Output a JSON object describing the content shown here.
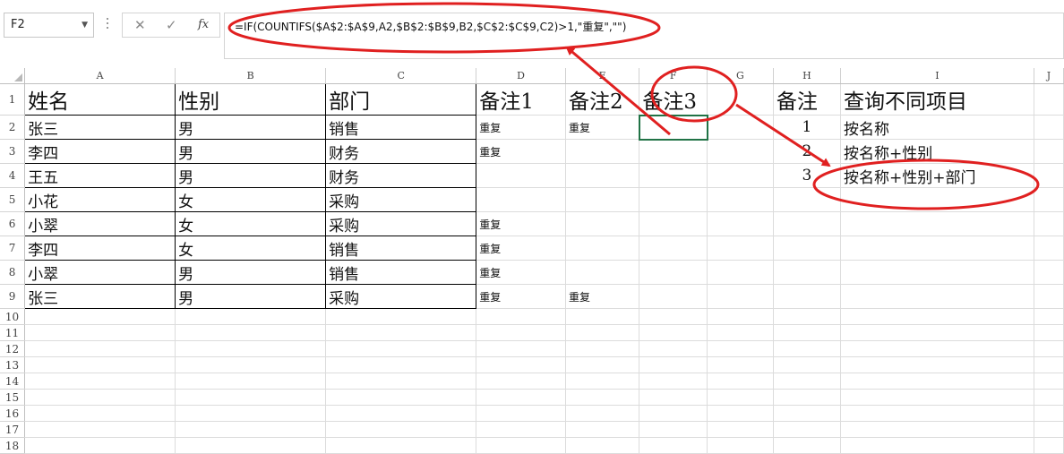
{
  "formula_bar": {
    "name_box": "F2",
    "cancel_icon": "✕",
    "enter_icon": "✓",
    "fx_label": "fx",
    "formula": "=IF(COUNTIFS($A$2:$A$9,A2,$B$2:$B$9,B2,$C$2:$C$9,C2)>1,\"重复\",\"\")"
  },
  "columns": [
    "A",
    "B",
    "C",
    "D",
    "E",
    "F",
    "G",
    "H",
    "I",
    "J"
  ],
  "rows": [
    {
      "num": "1",
      "cells": [
        "姓名",
        "性别",
        "部门",
        "备注1",
        "备注2",
        "备注3",
        "",
        "备注",
        "查询不同项目",
        ""
      ]
    },
    {
      "num": "2",
      "cells": [
        "张三",
        "男",
        "销售",
        "重复",
        "重复",
        "",
        "",
        "1",
        "按名称",
        ""
      ]
    },
    {
      "num": "3",
      "cells": [
        "李四",
        "男",
        "财务",
        "重复",
        "",
        "",
        "",
        "2",
        "按名称+性别",
        ""
      ]
    },
    {
      "num": "4",
      "cells": [
        "王五",
        "男",
        "财务",
        "",
        "",
        "",
        "",
        "3",
        "按名称+性别+部门",
        ""
      ]
    },
    {
      "num": "5",
      "cells": [
        "小花",
        "女",
        "采购",
        "",
        "",
        "",
        "",
        "",
        "",
        ""
      ]
    },
    {
      "num": "6",
      "cells": [
        "小翠",
        "女",
        "采购",
        "重复",
        "",
        "",
        "",
        "",
        "",
        ""
      ]
    },
    {
      "num": "7",
      "cells": [
        "李四",
        "女",
        "销售",
        "重复",
        "",
        "",
        "",
        "",
        "",
        ""
      ]
    },
    {
      "num": "8",
      "cells": [
        "小翠",
        "男",
        "销售",
        "重复",
        "",
        "",
        "",
        "",
        "",
        ""
      ]
    },
    {
      "num": "9",
      "cells": [
        "张三",
        "男",
        "采购",
        "重复",
        "重复",
        "",
        "",
        "",
        "",
        ""
      ]
    },
    {
      "num": "10",
      "cells": [
        "",
        "",
        "",
        "",
        "",
        "",
        "",
        "",
        "",
        ""
      ]
    },
    {
      "num": "11",
      "cells": [
        "",
        "",
        "",
        "",
        "",
        "",
        "",
        "",
        "",
        ""
      ]
    },
    {
      "num": "12",
      "cells": [
        "",
        "",
        "",
        "",
        "",
        "",
        "",
        "",
        "",
        ""
      ]
    },
    {
      "num": "13",
      "cells": [
        "",
        "",
        "",
        "",
        "",
        "",
        "",
        "",
        "",
        ""
      ]
    },
    {
      "num": "14",
      "cells": [
        "",
        "",
        "",
        "",
        "",
        "",
        "",
        "",
        "",
        ""
      ]
    },
    {
      "num": "15",
      "cells": [
        "",
        "",
        "",
        "",
        "",
        "",
        "",
        "",
        "",
        ""
      ]
    },
    {
      "num": "16",
      "cells": [
        "",
        "",
        "",
        "",
        "",
        "",
        "",
        "",
        "",
        ""
      ]
    },
    {
      "num": "17",
      "cells": [
        "",
        "",
        "",
        "",
        "",
        "",
        "",
        "",
        "",
        ""
      ]
    },
    {
      "num": "18",
      "cells": [
        "",
        "",
        "",
        "",
        "",
        "",
        "",
        "",
        "",
        ""
      ]
    }
  ],
  "annotation_color": "#e02020",
  "selection_color": "#217346"
}
